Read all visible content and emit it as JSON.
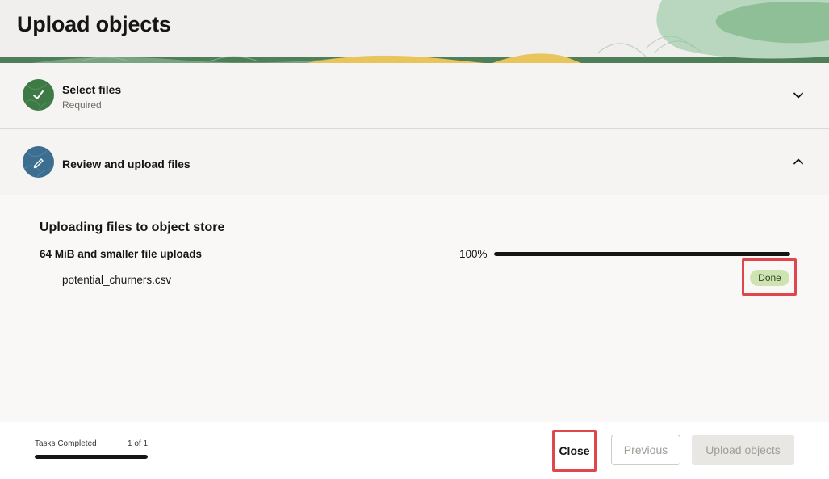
{
  "header": {
    "title": "Upload objects"
  },
  "steps": [
    {
      "title": "Select files",
      "subtitle": "Required",
      "icon": "check-icon",
      "state": "completed",
      "expanded": false
    },
    {
      "title": "Review and upload files",
      "icon": "pencil-icon",
      "state": "active",
      "expanded": true
    }
  ],
  "content": {
    "section_title": "Uploading files to object store",
    "group_label": "64 MiB and smaller file uploads",
    "progress_text": "100%",
    "progress_value": 1.0,
    "files": [
      {
        "name": "potential_churners.csv",
        "status": "Done"
      }
    ]
  },
  "footer": {
    "tasks_label": "Tasks Completed",
    "tasks_count": "1 of 1",
    "tasks_progress": 1.0,
    "close_label": "Close",
    "previous_label": "Previous",
    "upload_label": "Upload objects"
  },
  "colors": {
    "done_badge_bg": "#cfe3b2",
    "highlight_outline": "#e0474c",
    "step_complete": "#3e7a46",
    "step_active": "#3b6e8f"
  }
}
